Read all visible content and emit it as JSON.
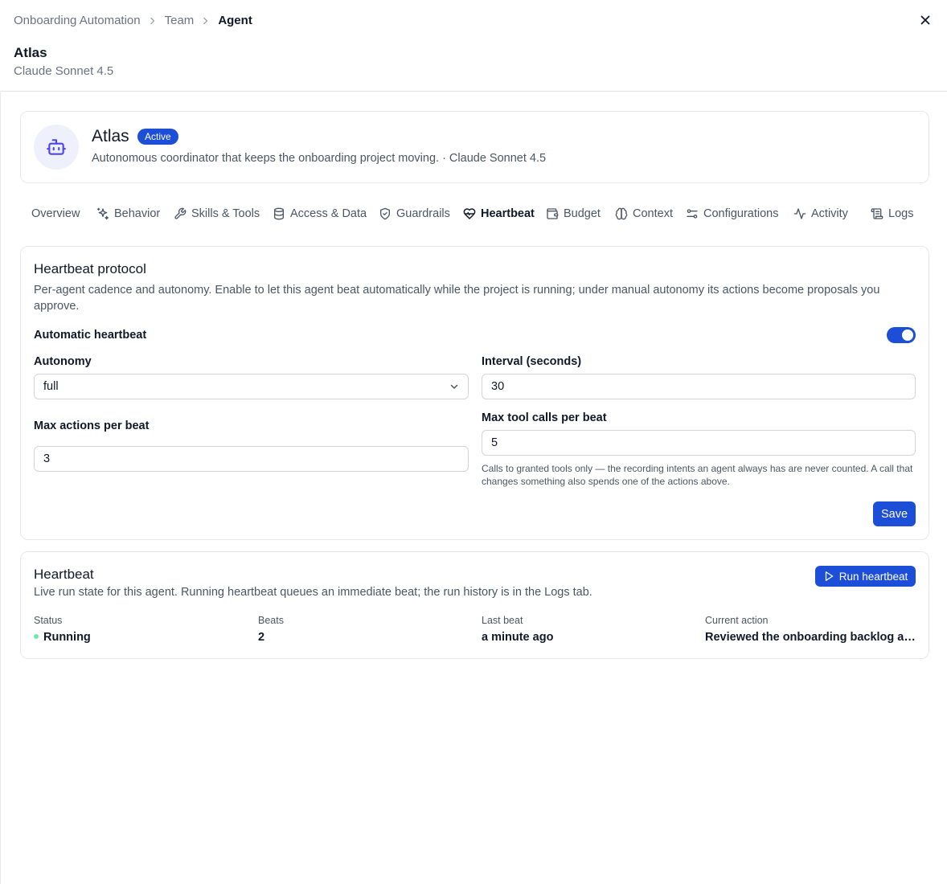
{
  "breadcrumb": {
    "items": [
      "Onboarding Automation",
      "Team"
    ],
    "current": "Agent"
  },
  "header": {
    "title": "Atlas",
    "subtitle": "Claude Sonnet 4.5"
  },
  "profile": {
    "name": "Atlas",
    "status": "Active",
    "description": "Autonomous coordinator that keeps the onboarding project moving. · Claude Sonnet 4.5",
    "avatar_icon": "bot-icon",
    "badge_color": "#1d4ed8"
  },
  "tabs": [
    {
      "label": "Overview",
      "icon": ""
    },
    {
      "label": "Behavior",
      "icon": "sparkles-icon"
    },
    {
      "label": "Skills & Tools",
      "icon": "wrench-icon"
    },
    {
      "label": "Access & Data",
      "icon": "database-icon"
    },
    {
      "label": "Guardrails",
      "icon": "shield-icon"
    },
    {
      "label": "Heartbeat",
      "icon": "heart-pulse-icon",
      "active": true
    },
    {
      "label": "Budget",
      "icon": "wallet-icon"
    },
    {
      "label": "Context",
      "icon": "brain-icon"
    },
    {
      "label": "Configurations",
      "icon": "sliders-icon"
    },
    {
      "label": "Activity",
      "icon": "activity-icon"
    },
    {
      "label": "Logs",
      "icon": "scroll-icon"
    }
  ],
  "protocol": {
    "title": "Heartbeat protocol",
    "description": "Per-agent cadence and autonomy. Enable to let this agent beat automatically while the project is running; under manual autonomy its actions become proposals you approve.",
    "auto_label": "Automatic heartbeat",
    "auto_enabled": true,
    "autonomy_label": "Autonomy",
    "autonomy_value": "full",
    "interval_label": "Interval (seconds)",
    "interval_value": "30",
    "max_actions_label": "Max actions per beat",
    "max_actions_value": "3",
    "max_tools_label": "Max tool calls per beat",
    "max_tools_value": "5",
    "max_tools_hint": "Calls to granted tools only — the recording intents an agent always has are never counted. A call that changes something also spends one of the actions above.",
    "save_label": "Save"
  },
  "run": {
    "title": "Heartbeat",
    "description": "Live run state for this agent. Running heartbeat queues an immediate beat; the run history is in the Logs tab.",
    "run_button": "Run heartbeat",
    "stats": {
      "status_label": "Status",
      "status_value": "Running",
      "status_color": "#6ee7b7",
      "beats_label": "Beats",
      "beats_value": "2",
      "last_label": "Last beat",
      "last_value": "a minute ago",
      "action_label": "Current action",
      "action_value": "Reviewed the onboarding backlog and assigned next steps"
    }
  },
  "colors": {
    "accent": "#1d4ed8",
    "border": "#e5e7eb",
    "muted_text": "#4b5563"
  }
}
